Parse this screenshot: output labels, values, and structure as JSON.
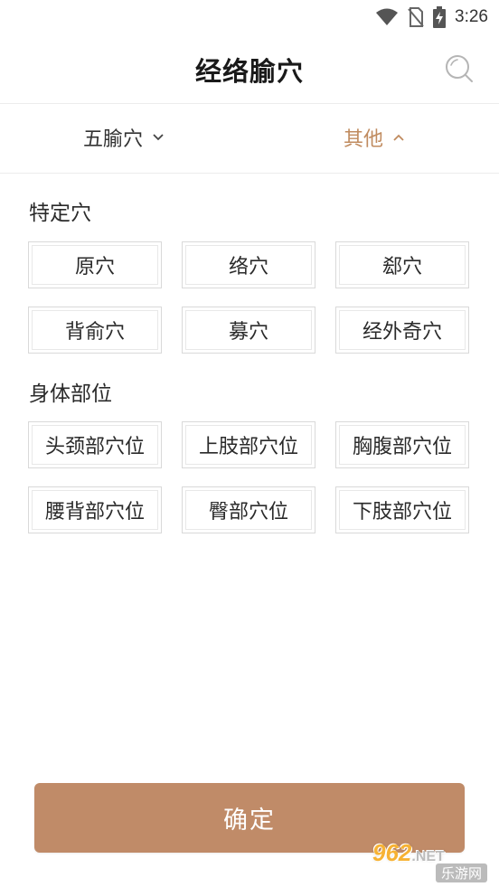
{
  "status_bar": {
    "time": "3:26"
  },
  "header": {
    "title": "经络腧穴"
  },
  "filters": [
    {
      "label": "五腧穴",
      "state": "collapsed"
    },
    {
      "label": "其他",
      "state": "expanded",
      "active_color": "#c08b5f"
    }
  ],
  "sections": [
    {
      "title": "特定穴",
      "tags": [
        "原穴",
        "络穴",
        "郄穴",
        "背俞穴",
        "募穴",
        "经外奇穴"
      ]
    },
    {
      "title": "身体部位",
      "tags": [
        "头颈部穴位",
        "上肢部穴位",
        "胸腹部穴位",
        "腰背部穴位",
        "臀部穴位",
        "下肢部穴位"
      ]
    }
  ],
  "confirm": {
    "label": "确定",
    "color": "#c08b68"
  },
  "watermark": {
    "main": "962",
    "suffix": ".NET",
    "sub": "乐游网"
  }
}
